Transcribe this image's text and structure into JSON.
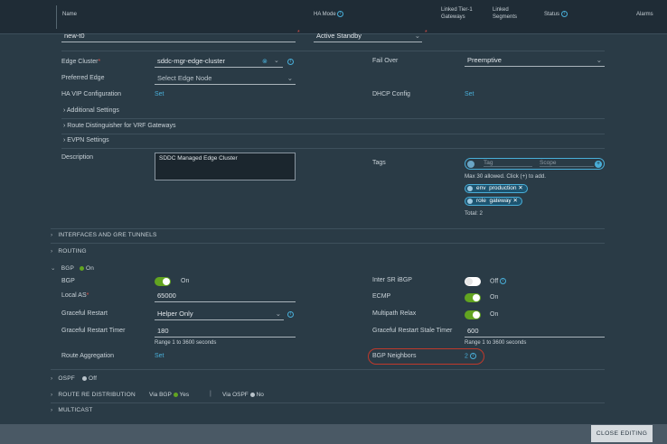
{
  "header": {
    "columns": [
      "Name",
      "HA Mode",
      "Linked Tier-1 Gateways",
      "Linked Segments",
      "Status",
      "Alarms"
    ]
  },
  "form": {
    "name_value": "new-t0",
    "ha_mode_value": "Active Standby",
    "edge_cluster_label": "Edge Cluster",
    "edge_cluster_value": "sddc-mgr-edge-cluster",
    "fail_over_label": "Fail Over",
    "fail_over_value": "Preemptive",
    "preferred_edge_label": "Preferred Edge",
    "preferred_edge_placeholder": "Select Edge Node",
    "ha_vip_label": "HA VIP Configuration",
    "ha_vip_link": "Set",
    "dhcp_label": "DHCP Config",
    "dhcp_link": "Set",
    "additional_settings": "Additional Settings",
    "route_distinguisher": "Route Distinguisher for VRF Gateways",
    "evpn_settings": "EVPN Settings",
    "description_label": "Description",
    "description_value": "SDDC Managed Edge Cluster",
    "tags_label": "Tags",
    "tag_placeholder": "Tag",
    "scope_placeholder": "Scope",
    "tags_hint": "Max 30 allowed. Click (+) to add.",
    "tags": [
      {
        "tag": "env",
        "scope": "production"
      },
      {
        "tag": "role",
        "scope": "gateway"
      }
    ],
    "tags_total": "Total: 2"
  },
  "sections": {
    "interfaces": "INTERFACES AND GRE TUNNELS",
    "routing": "ROUTING",
    "bgp": "BGP",
    "bgp_status": "On",
    "ospf": "OSPF",
    "ospf_status": "Off",
    "redistribution": "ROUTE RE DISTRIBUTION",
    "via_bgp": "Via BGP",
    "via_bgp_value": "Yes",
    "via_ospf": "Via OSPF",
    "via_ospf_value": "No",
    "multicast": "MULTICAST"
  },
  "bgp": {
    "bgp_label": "BGP",
    "bgp_toggle": "On",
    "bgp_enabled": true,
    "inter_sr_label": "Inter SR iBGP",
    "inter_sr_toggle": "Off",
    "inter_sr_enabled": false,
    "local_as_label": "Local AS",
    "local_as_value": "65000",
    "ecmp_label": "ECMP",
    "ecmp_toggle": "On",
    "ecmp_enabled": true,
    "graceful_restart_label": "Graceful Restart",
    "graceful_restart_value": "Helper Only",
    "multipath_label": "Multipath Relax",
    "multipath_toggle": "On",
    "multipath_enabled": true,
    "gr_timer_label": "Graceful Restart Timer",
    "gr_timer_value": "180",
    "gr_timer_hint": "Range 1 to 3600 seconds",
    "gr_stale_label": "Graceful Restart Stale Timer",
    "gr_stale_value": "600",
    "gr_stale_hint": "Range 1 to 3600 seconds",
    "route_agg_label": "Route Aggregation",
    "route_agg_link": "Set",
    "neighbors_label": "BGP Neighbors",
    "neighbors_value": "2"
  },
  "footer": {
    "close_editing": "CLOSE EDITING"
  },
  "colors": {
    "accent": "#49afd9",
    "toggle_on": "#62a420",
    "required": "#e0524a",
    "highlight": "#c0392b"
  }
}
